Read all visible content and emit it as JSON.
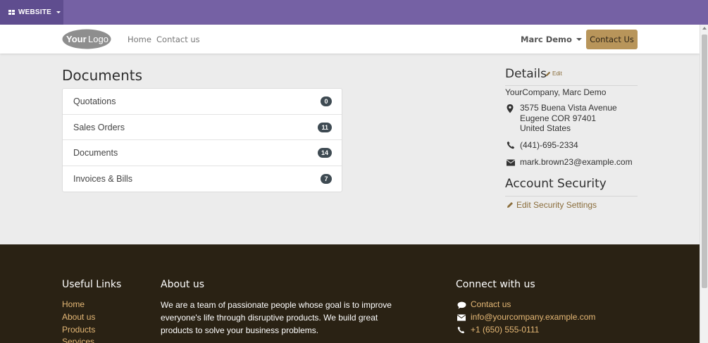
{
  "adminbar": {
    "website_label": "WEBSITE"
  },
  "navbar": {
    "logo_text": "YourLogo",
    "links": [
      "Home",
      "Contact us"
    ],
    "user_name": "Marc Demo",
    "cta_label": "Contact Us"
  },
  "documents": {
    "title": "Documents",
    "items": [
      {
        "label": "Quotations",
        "count": "0"
      },
      {
        "label": "Sales Orders",
        "count": "11"
      },
      {
        "label": "Documents",
        "count": "14"
      },
      {
        "label": "Invoices & Bills",
        "count": "7"
      }
    ]
  },
  "details": {
    "title": "Details",
    "edit_label": "Edit",
    "company": "YourCompany, Marc Demo",
    "address": [
      "3575 Buena Vista Avenue",
      "Eugene COR 97401",
      "United States"
    ],
    "phone": "(441)-695-2334",
    "email": "mark.brown23@example.com"
  },
  "security": {
    "title": "Account Security",
    "edit_label": "Edit Security Settings"
  },
  "footer": {
    "useful_links_title": "Useful Links",
    "useful_links": [
      "Home",
      "About us",
      "Products",
      "Services"
    ],
    "about_title": "About us",
    "about_text": "We are a team of passionate people whose goal is to improve everyone's life through disruptive products. We build great products to solve your business problems.",
    "connect_title": "Connect with us",
    "connect": [
      {
        "icon": "comment-icon",
        "label": "Contact us"
      },
      {
        "icon": "envelope-icon",
        "label": "info@yourcompany.example.com"
      },
      {
        "icon": "phone-icon",
        "label": "+1 (650) 555-0111"
      }
    ]
  },
  "colors": {
    "adminbar": "#7561a4",
    "accent": "#b8955a",
    "footer": "#2a2214",
    "footer_link": "#e5b876"
  }
}
